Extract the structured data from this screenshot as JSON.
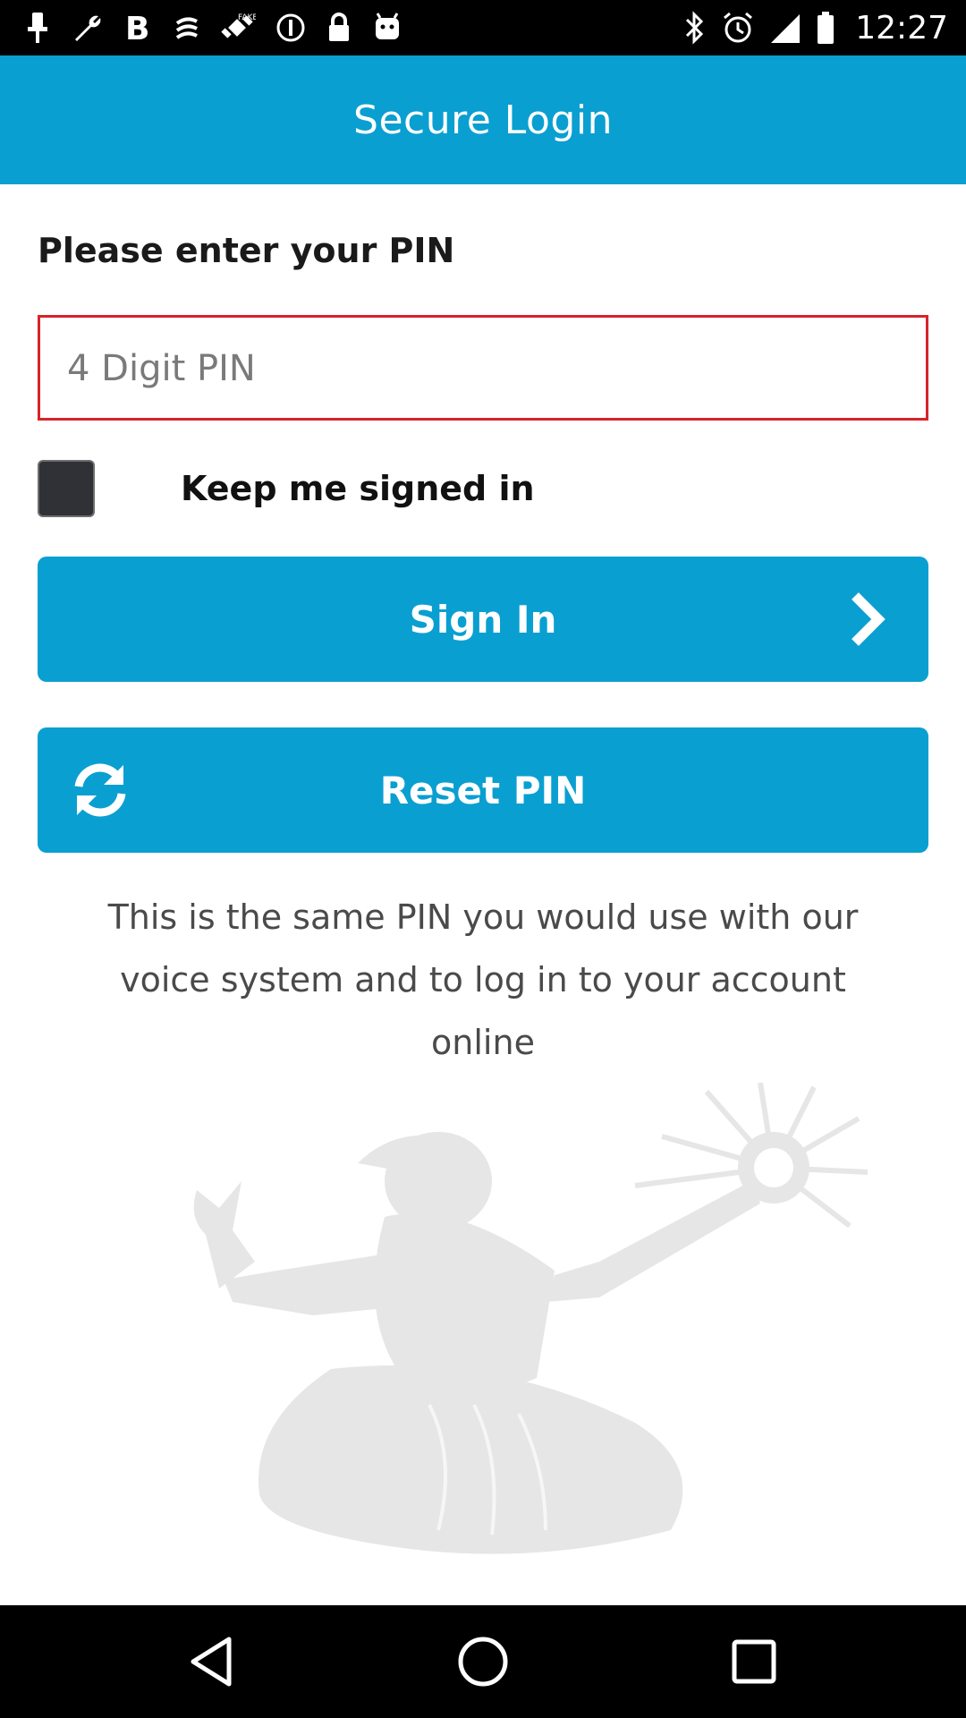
{
  "status_bar": {
    "time": "12:27",
    "left_icons": [
      "pin-icon",
      "wrench-icon",
      "bold-b-icon",
      "sprint-icon",
      "fake-gps-icon",
      "info-circle-icon",
      "lock-icon",
      "android-icon"
    ],
    "right_icons": [
      "bluetooth-icon",
      "alarm-icon",
      "signal-icon",
      "battery-icon"
    ]
  },
  "app_bar": {
    "title": "Secure Login"
  },
  "form": {
    "prompt": "Please enter your PIN",
    "pin_placeholder": "4 Digit PIN",
    "pin_value": "",
    "keep_signed_in_label": "Keep me signed in",
    "keep_signed_in_checked": false,
    "sign_in_label": "Sign In",
    "reset_pin_label": "Reset PIN"
  },
  "info_text": "This is the same PIN you would use with our voice system and to log in to your account online",
  "colors": {
    "accent": "#0a9fd1",
    "error_border": "#d8232a",
    "background": "#ffffff"
  },
  "nav_bar": {
    "icons": [
      "back-icon",
      "home-icon",
      "recents-icon"
    ]
  }
}
